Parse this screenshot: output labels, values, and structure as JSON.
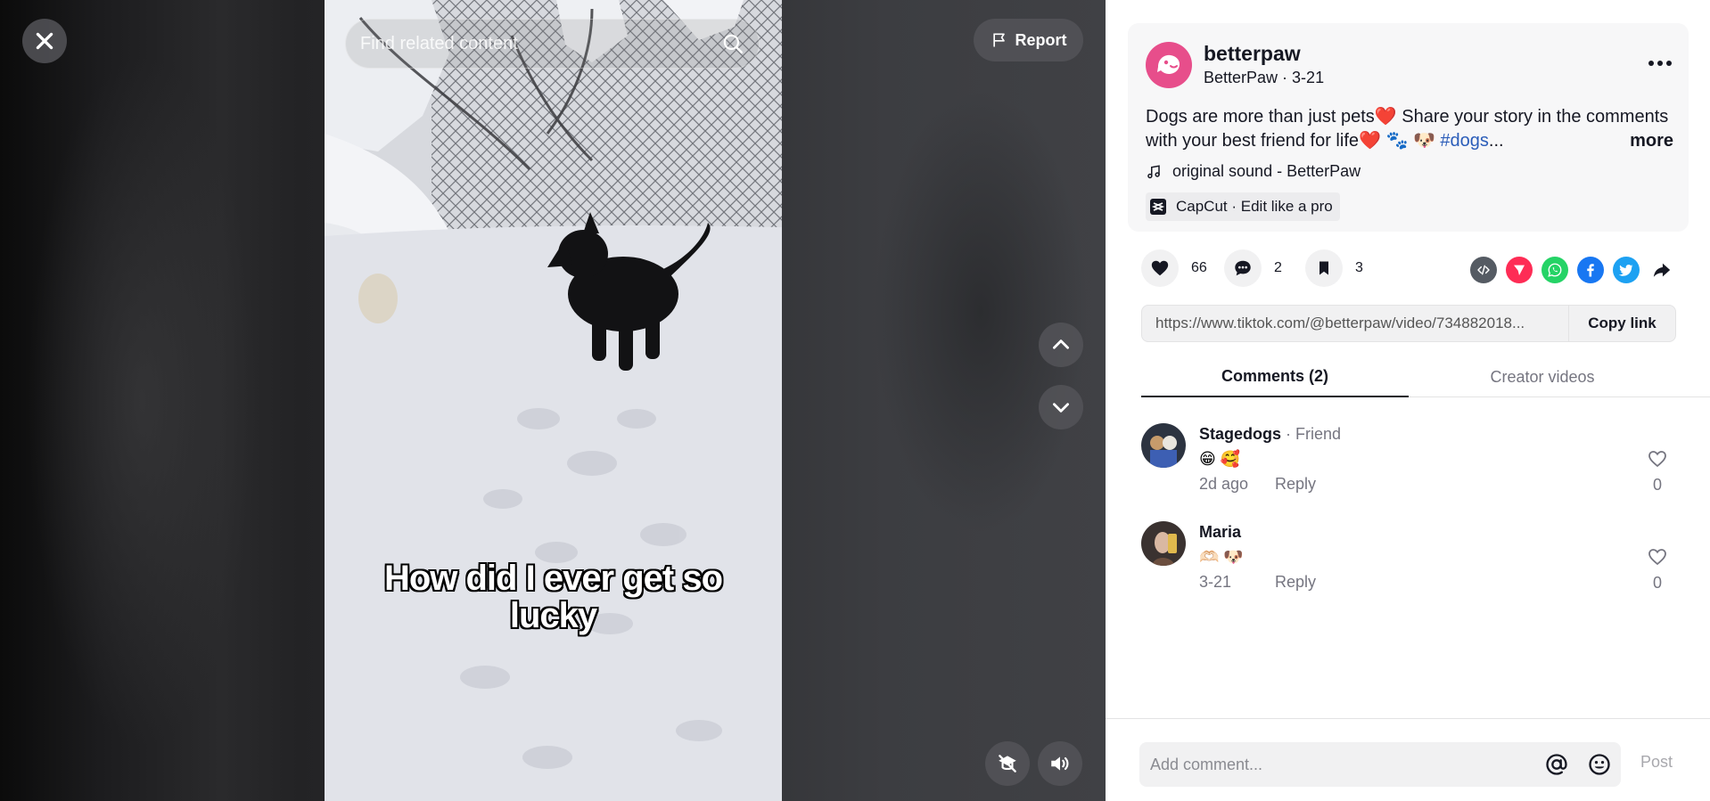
{
  "search": {
    "placeholder": "Find related content"
  },
  "report_label": "Report",
  "video": {
    "caption_line1": "How did I ever get so",
    "caption_line2": "lucky"
  },
  "post": {
    "username": "betterpaw",
    "display_name": "BetterPaw",
    "date": "3-21",
    "meta_separator": " · ",
    "description_part1": "Dogs are more than just pets",
    "description_part2": " Share your story in the comments with your best friend for life",
    "description_hashtag": "#dogs",
    "description_ellipsis": "...",
    "more_label": "more",
    "emoji_heart": "❤️",
    "emoji_paw": "🐾",
    "emoji_dog": "🐶",
    "sound": "original sound - BetterPaw",
    "capcut": "CapCut · Edit like a pro"
  },
  "stats": {
    "likes": "66",
    "comments": "2",
    "saves": "3"
  },
  "link": {
    "url": "https://www.tiktok.com/@betterpaw/video/734882018...",
    "copy_label": "Copy link"
  },
  "tabs": [
    {
      "label": "Comments (2)"
    },
    {
      "label": "Creator videos"
    }
  ],
  "comments": [
    {
      "name": "Stagedogs",
      "relation": " · Friend",
      "emojis": "😁 🥰",
      "time": "2d ago",
      "reply": "Reply",
      "likes": "0"
    },
    {
      "name": "Maria",
      "relation": "",
      "emojis": "🫶🏻 🐶",
      "time": "3-21",
      "reply": "Reply",
      "likes": "0"
    }
  ],
  "footer": {
    "placeholder": "Add comment...",
    "post_label": "Post"
  },
  "colors": {
    "brand_pink": "#e74e8b",
    "hashtag": "#2b5db9",
    "embed": "#555b63",
    "telegram": "#fe2c55",
    "whatsapp": "#25d366",
    "facebook": "#1877f2",
    "twitter": "#1da1f2"
  },
  "icons": [
    "close-icon",
    "search-icon",
    "flag-icon",
    "chevron-up-icon",
    "chevron-down-icon",
    "pip-icon",
    "volume-icon",
    "more-icon",
    "music-note-icon",
    "capcut-icon",
    "heart-icon",
    "comment-icon",
    "bookmark-icon",
    "embed-icon",
    "send-icon",
    "whatsapp-icon",
    "facebook-icon",
    "twitter-icon",
    "share-arrow-icon",
    "mention-icon",
    "emoji-icon"
  ]
}
